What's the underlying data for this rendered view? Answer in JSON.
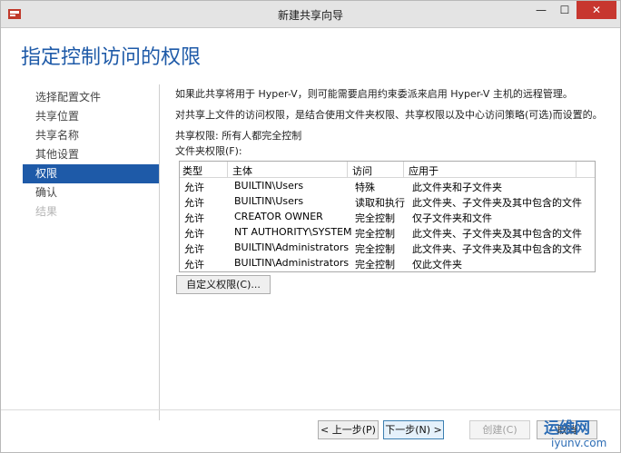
{
  "window": {
    "title": "新建共享向导"
  },
  "heading": "指定控制访问的权限",
  "nav": {
    "items": [
      {
        "label": "选择配置文件",
        "state": "normal"
      },
      {
        "label": "共享位置",
        "state": "normal"
      },
      {
        "label": "共享名称",
        "state": "normal"
      },
      {
        "label": "其他设置",
        "state": "normal"
      },
      {
        "label": "权限",
        "state": "active"
      },
      {
        "label": "确认",
        "state": "normal"
      },
      {
        "label": "结果",
        "state": "disabled"
      }
    ]
  },
  "content": {
    "intro": "如果此共享将用于 Hyper-V，则可能需要启用约束委派来启用 Hyper-V 主机的远程管理。",
    "description": "对共享上文件的访问权限，是结合使用文件夹权限、共享权限以及中心访问策略(可选)而设置的。",
    "share_permissions": "共享权限: 所有人都完全控制",
    "folder_permissions_label": "文件夹权限(F):",
    "table": {
      "headers": [
        "类型",
        "主体",
        "访问",
        "应用于"
      ],
      "rows": [
        [
          "允许",
          "BUILTIN\\Users",
          "特殊",
          "此文件夹和子文件夹"
        ],
        [
          "允许",
          "BUILTIN\\Users",
          "读取和执行",
          "此文件夹、子文件夹及其中包含的文件"
        ],
        [
          "允许",
          "CREATOR OWNER",
          "完全控制",
          "仅子文件夹和文件"
        ],
        [
          "允许",
          "NT AUTHORITY\\SYSTEM",
          "完全控制",
          "此文件夹、子文件夹及其中包含的文件"
        ],
        [
          "允许",
          "BUILTIN\\Administrators",
          "完全控制",
          "此文件夹、子文件夹及其中包含的文件"
        ],
        [
          "允许",
          "BUILTIN\\Administrators",
          "完全控制",
          "仅此文件夹"
        ]
      ]
    },
    "custom_permissions_button": "自定义权限(C)..."
  },
  "footer": {
    "prev": "< 上一步(P)",
    "next": "下一步(N) >",
    "create": "创建(C)",
    "cancel": "取消"
  },
  "watermark": {
    "line1": "运维网",
    "line2": "iyunv.com"
  }
}
